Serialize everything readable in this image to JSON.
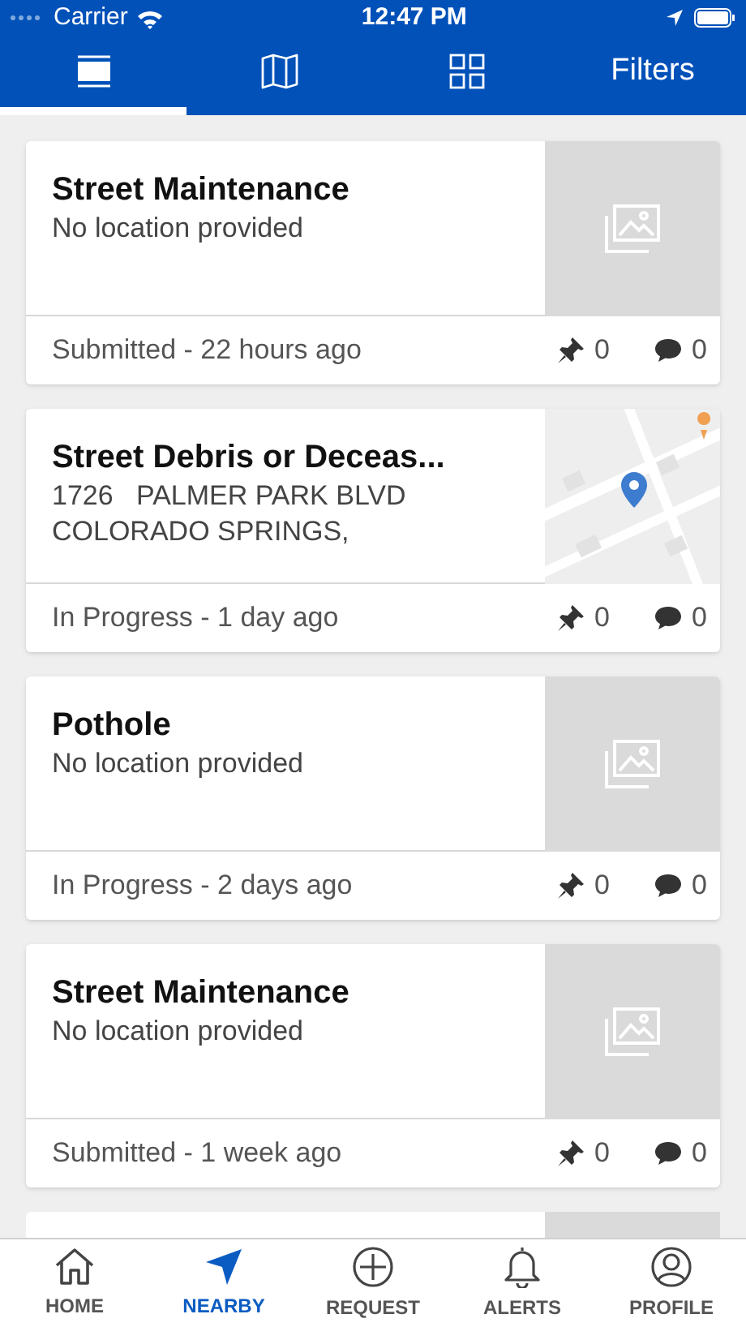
{
  "status_bar": {
    "carrier": "Carrier",
    "time": "12:47 PM"
  },
  "tabs": [
    {
      "kind": "list",
      "selected": true
    },
    {
      "kind": "map",
      "selected": false
    },
    {
      "kind": "grid",
      "selected": false
    },
    {
      "kind": "text",
      "label": "Filters",
      "selected": false
    }
  ],
  "cards": [
    {
      "title": "Street Maintenance",
      "address": [
        "No location provided"
      ],
      "status": "Submitted - 22 hours ago",
      "pins": "0",
      "comments": "0",
      "kind": "placeholder"
    },
    {
      "title": "Street Debris or Deceas...",
      "address": [
        "1726   PALMER PARK BLVD",
        "COLORADO SPRINGS,"
      ],
      "status": "In Progress - 1 day ago",
      "pins": "0",
      "comments": "0",
      "kind": "map"
    },
    {
      "title": "Pothole",
      "address": [
        "No location provided"
      ],
      "status": "In Progress - 2 days ago",
      "pins": "0",
      "comments": "0",
      "kind": "placeholder"
    },
    {
      "title": "Street Maintenance",
      "address": [
        "No location provided"
      ],
      "status": "Submitted - 1 week ago",
      "pins": "0",
      "comments": "0",
      "kind": "placeholder"
    }
  ],
  "bottom_nav": [
    {
      "kind": "home",
      "label": "HOME",
      "selected": false
    },
    {
      "kind": "nearby",
      "label": "NEARBY",
      "selected": true
    },
    {
      "kind": "request",
      "label": "REQUEST",
      "selected": false
    },
    {
      "kind": "alerts",
      "label": "ALERTS",
      "selected": false
    },
    {
      "kind": "profile",
      "label": "PROFILE",
      "selected": false
    }
  ]
}
